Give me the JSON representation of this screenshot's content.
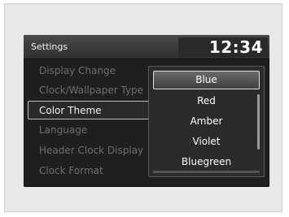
{
  "header": {
    "title": "Settings",
    "clock": "12:34"
  },
  "menu": {
    "items": [
      {
        "label": "Display Change",
        "state": "dim"
      },
      {
        "label": "Clock/Wallpaper Type",
        "state": "dim"
      },
      {
        "label": "Color Theme",
        "state": "selected"
      },
      {
        "label": "Language",
        "state": "dim"
      },
      {
        "label": "Header Clock Display",
        "state": "dim"
      },
      {
        "label": "Clock Format",
        "state": "dim"
      }
    ]
  },
  "popup": {
    "options": [
      "Blue",
      "Red",
      "Amber",
      "Violet",
      "Bluegreen"
    ],
    "selected": "Blue"
  },
  "colors": {
    "screen_bg": "#1f1f1f",
    "text_primary": "#f2f2f2",
    "text_dim": "#6e6e6e",
    "highlight_border": "#e0e0e0"
  }
}
